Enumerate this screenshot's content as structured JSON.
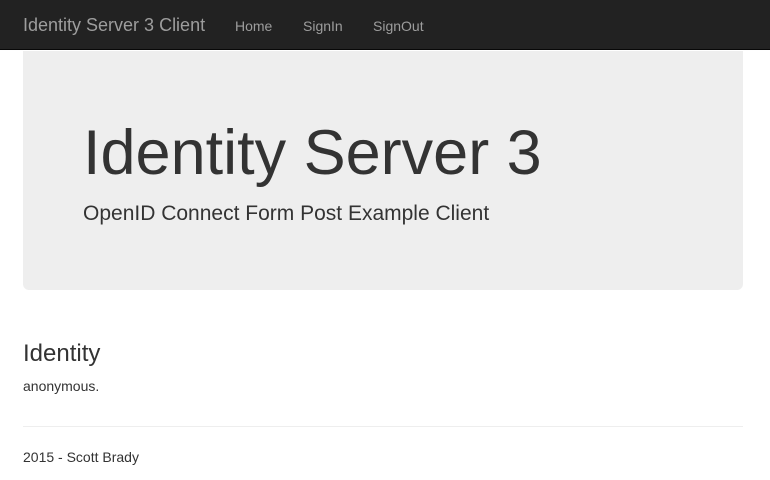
{
  "navbar": {
    "brand": "Identity Server 3 Client",
    "links": [
      {
        "label": "Home"
      },
      {
        "label": "SignIn"
      },
      {
        "label": "SignOut"
      }
    ],
    "background": "#222222",
    "link_color": "#9d9d9d"
  },
  "jumbotron": {
    "title": "Identity Server 3",
    "lead": "OpenID Connect Form Post Example Client",
    "background": "#eeeeee"
  },
  "identity": {
    "heading": "Identity",
    "text": "anonymous."
  },
  "footer": {
    "text": "2015 - Scott Brady"
  }
}
